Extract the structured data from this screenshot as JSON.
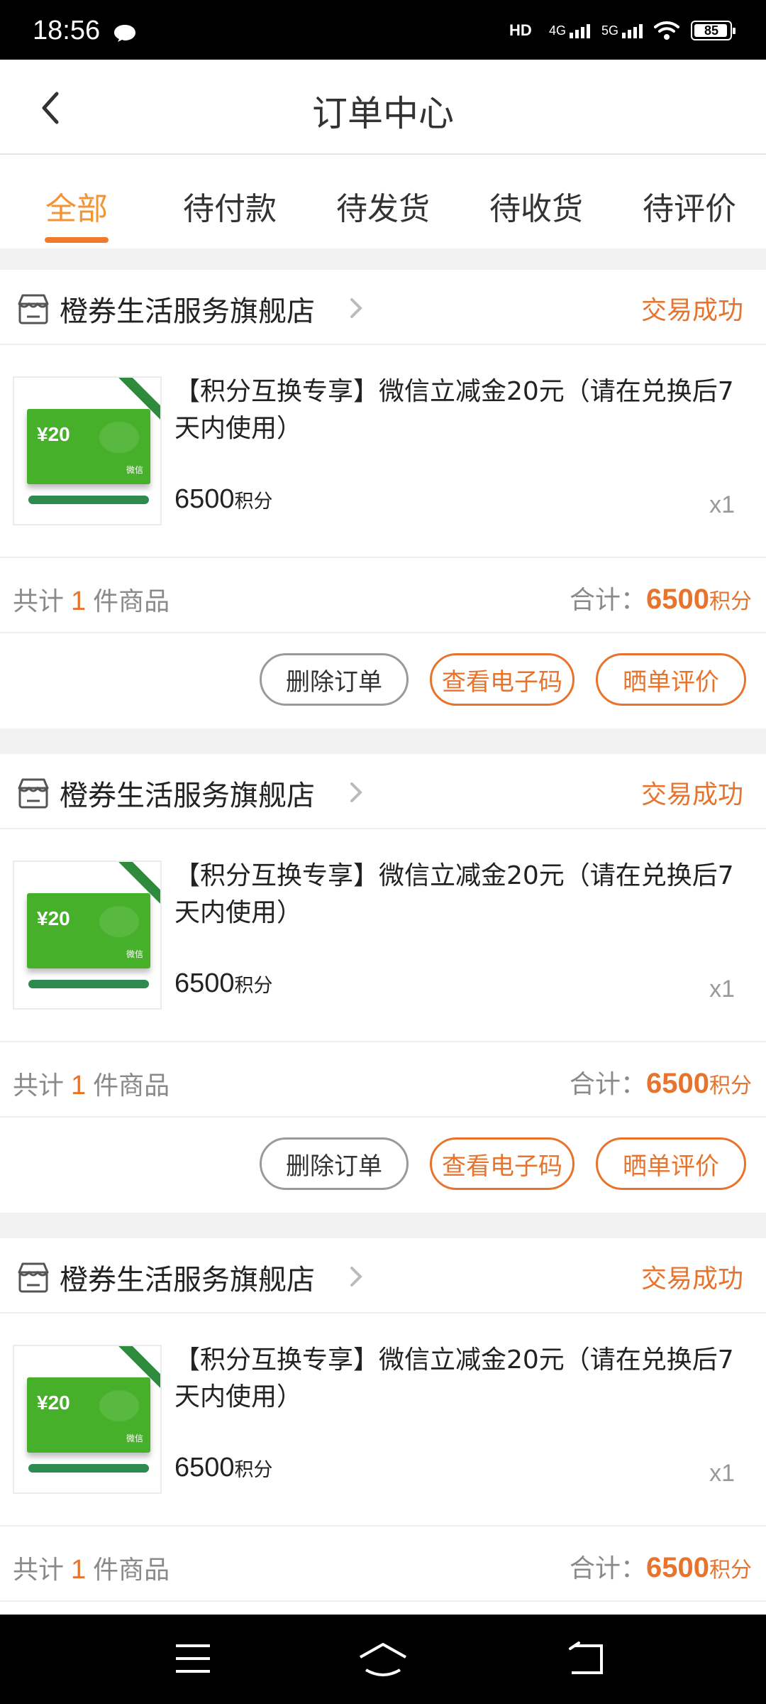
{
  "status_bar": {
    "time": "18:56",
    "hd_label": "HD",
    "net1_label": "4G",
    "net2_label": "5G",
    "battery": "85"
  },
  "header": {
    "title": "订单中心"
  },
  "tabs": [
    {
      "label": "全部"
    },
    {
      "label": "待付款"
    },
    {
      "label": "待发货"
    },
    {
      "label": "待收货"
    },
    {
      "label": "待评价"
    }
  ],
  "orders": [
    {
      "store": "橙券生活服务旗舰店",
      "status": "交易成功",
      "item_title": "【积分互换专享】微信立减金20元（请在兑换后7天内使用）",
      "thumb_amount": "¥20",
      "thumb_wechat": "微信",
      "price": "6500",
      "price_unit": "积分",
      "qty": "x1",
      "sum_prefix": "共计",
      "sum_count": "1",
      "sum_suffix": "件商品",
      "total_label": "合计：",
      "total": "6500",
      "total_unit": "积分",
      "buttons": [
        "删除订单",
        "查看电子码",
        "晒单评价"
      ]
    },
    {
      "store": "橙券生活服务旗舰店",
      "status": "交易成功",
      "item_title": "【积分互换专享】微信立减金20元（请在兑换后7天内使用）",
      "thumb_amount": "¥20",
      "thumb_wechat": "微信",
      "price": "6500",
      "price_unit": "积分",
      "qty": "x1",
      "sum_prefix": "共计",
      "sum_count": "1",
      "sum_suffix": "件商品",
      "total_label": "合计：",
      "total": "6500",
      "total_unit": "积分",
      "buttons": [
        "删除订单",
        "查看电子码",
        "晒单评价"
      ]
    },
    {
      "store": "橙券生活服务旗舰店",
      "status": "交易成功",
      "item_title": "【积分互换专享】微信立减金20元（请在兑换后7天内使用）",
      "thumb_amount": "¥20",
      "thumb_wechat": "微信",
      "price": "6500",
      "price_unit": "积分",
      "qty": "x1",
      "sum_prefix": "共计",
      "sum_count": "1",
      "sum_suffix": "件商品",
      "total_label": "合计：",
      "total": "6500",
      "total_unit": "积分"
    }
  ],
  "colors": {
    "accent": "#e8732c",
    "tab_active": "#f29434"
  },
  "icons": {
    "back": "chevron-left-icon",
    "store": "store-icon",
    "nav_menu": "menu-icon",
    "nav_home": "home-icon",
    "nav_back": "back-icon"
  }
}
